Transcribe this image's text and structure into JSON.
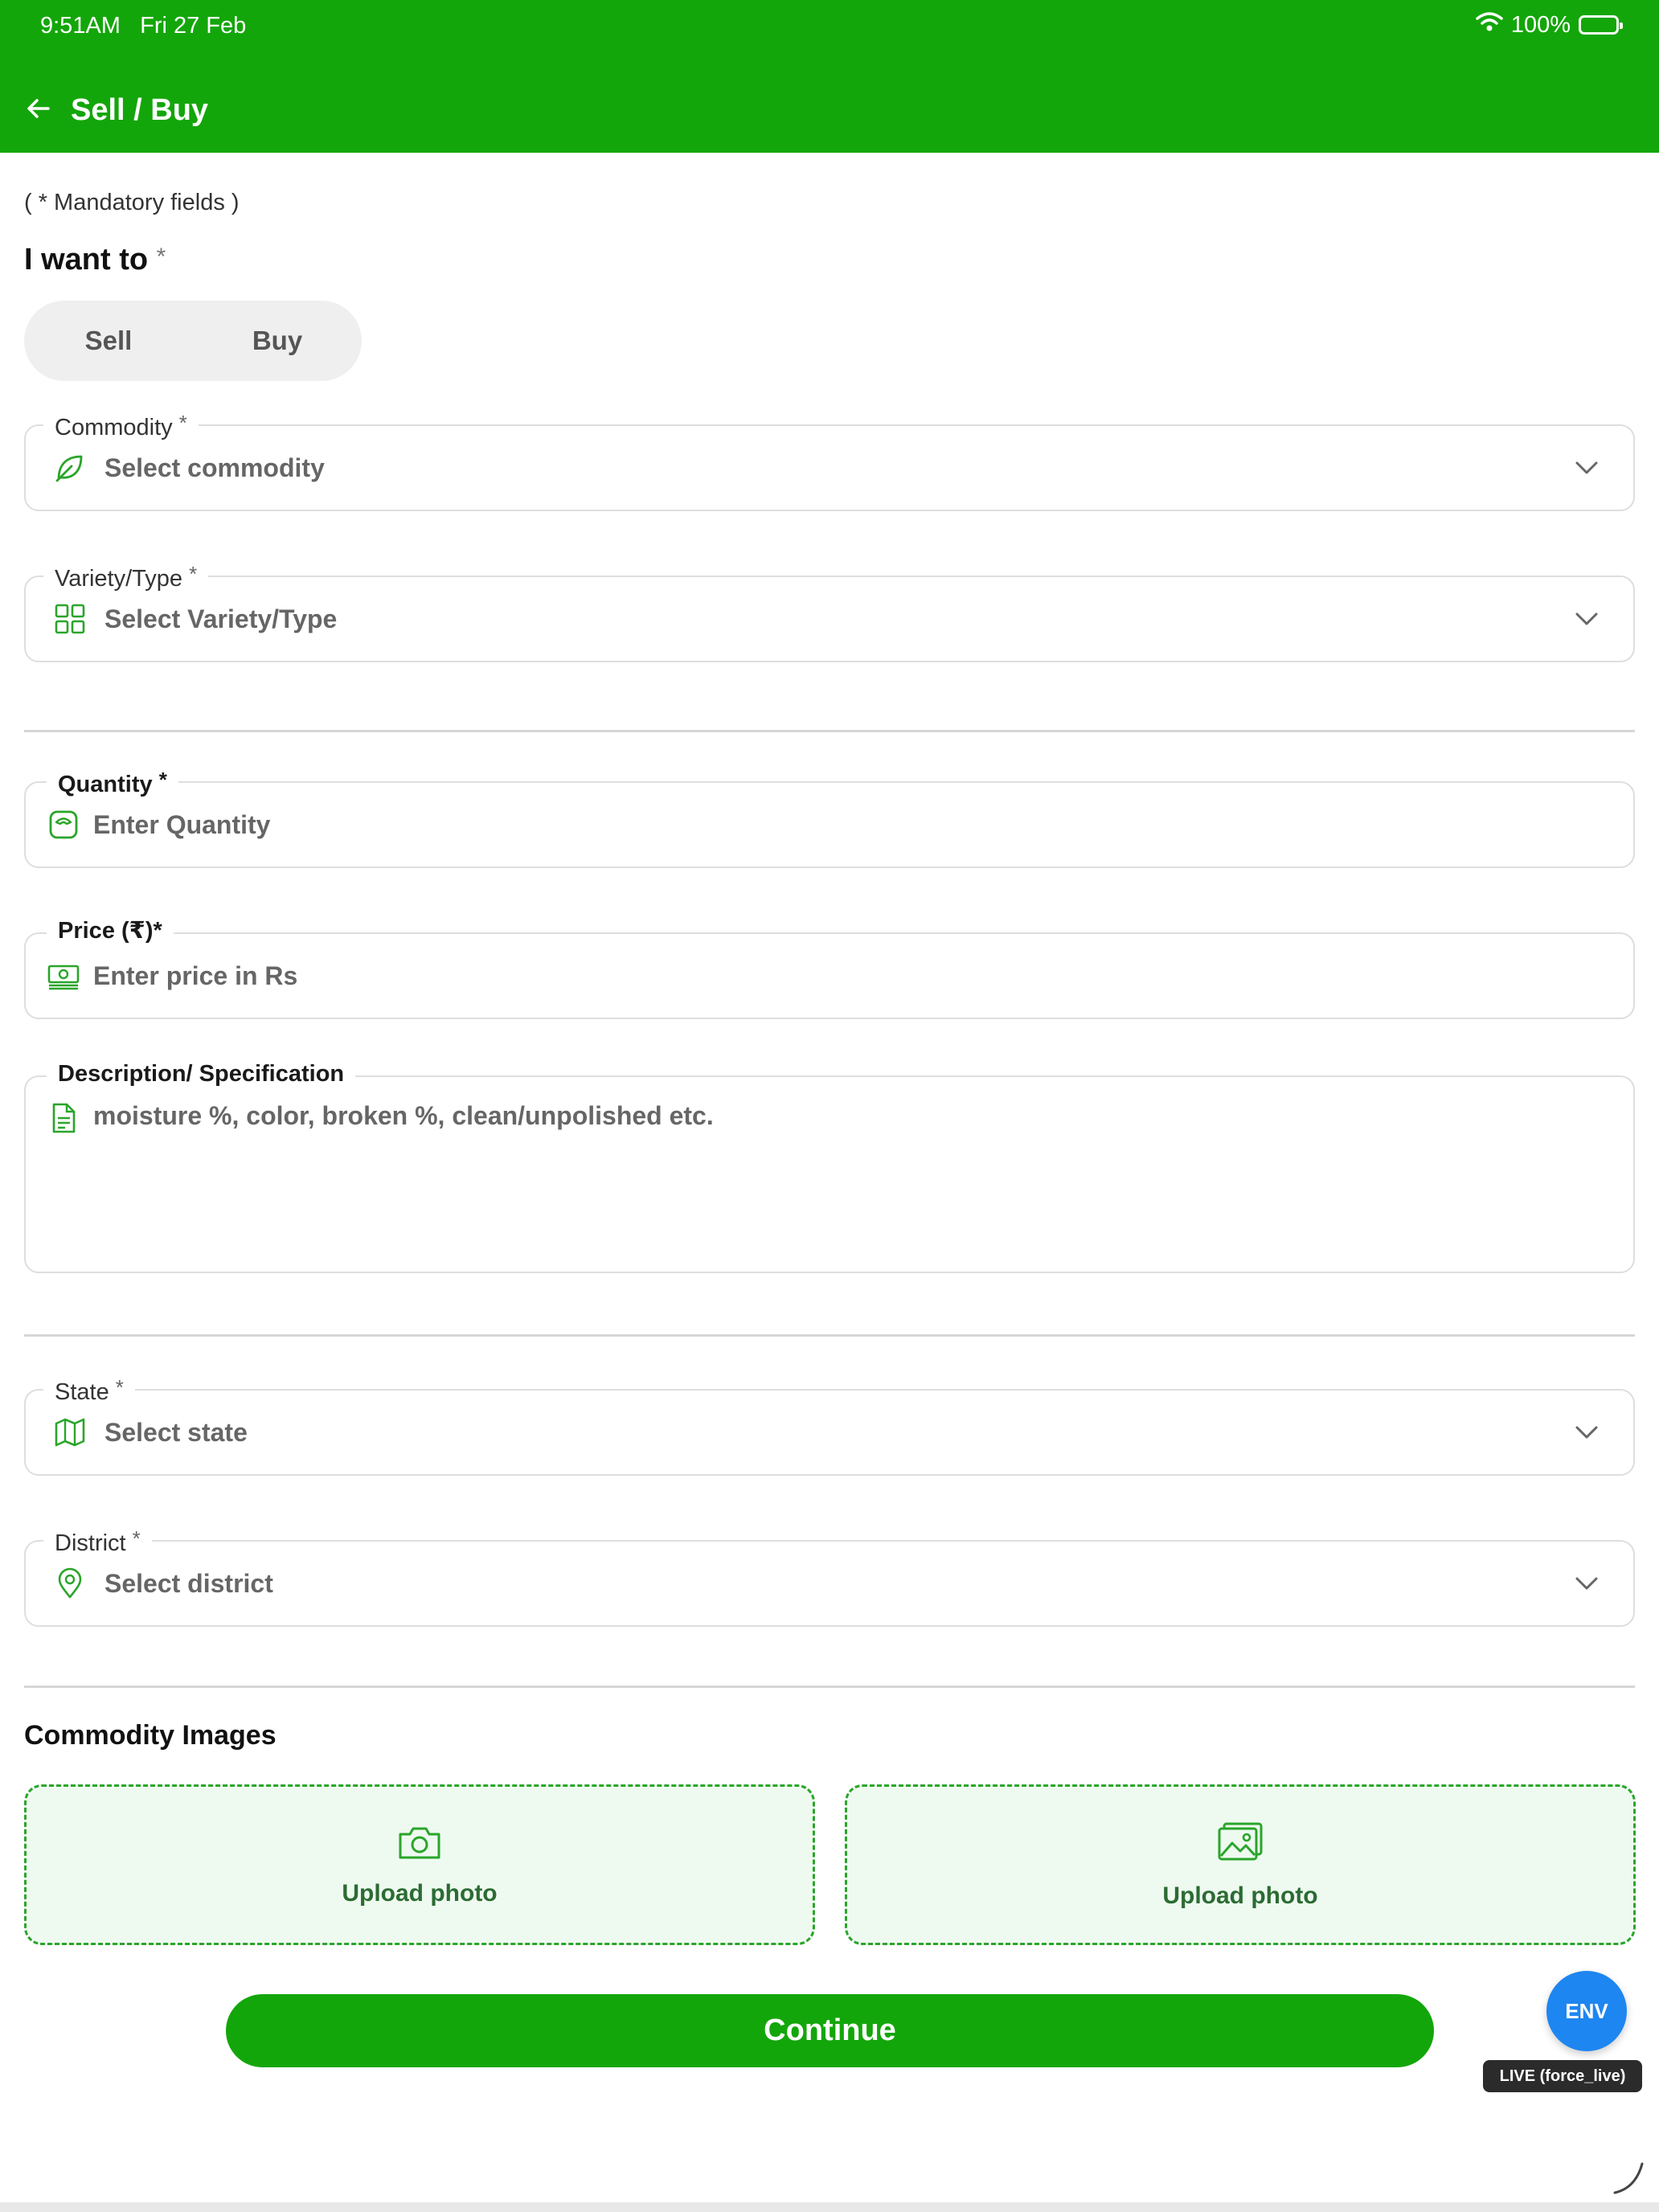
{
  "status_bar": {
    "time": "9:51AM",
    "date": "Fri 27 Feb",
    "battery": "100%"
  },
  "app_bar": {
    "title": "Sell / Buy"
  },
  "form": {
    "mandatory_note": "( * Mandatory fields )",
    "want_label": "I want to",
    "required_mark": "*",
    "toggle": {
      "options": [
        "Sell",
        "Buy"
      ]
    },
    "commodity": {
      "label": "Commodity",
      "placeholder": "Select commodity",
      "icon": "leaf-icon"
    },
    "variety": {
      "label": "Variety/Type",
      "placeholder": "Select Variety/Type",
      "icon": "grid-icon"
    },
    "quantity": {
      "label": "Quantity",
      "placeholder": "Enter Quantity",
      "icon": "scale-icon"
    },
    "price": {
      "label": "Price (₹)*",
      "placeholder": "Enter price in Rs",
      "icon": "cash-icon"
    },
    "description": {
      "label": "Description/ Specification",
      "placeholder": "moisture %, color, broken %, clean/unpolished etc.",
      "icon": "document-icon"
    },
    "state": {
      "label": "State",
      "placeholder": "Select state",
      "icon": "map-icon"
    },
    "district": {
      "label": "District",
      "placeholder": "Select district",
      "icon": "location-pin-icon"
    }
  },
  "images": {
    "title": "Commodity Images",
    "camera_label": "Upload photo",
    "gallery_label": "Upload photo"
  },
  "continue_label": "Continue",
  "env_button": "ENV",
  "env_badge": "LIVE (force_live)",
  "colors": {
    "primary": "#13a60a",
    "env_blue": "#1e86f0",
    "upload_bg": "#eefaf0",
    "upload_border": "#2aa52a"
  }
}
